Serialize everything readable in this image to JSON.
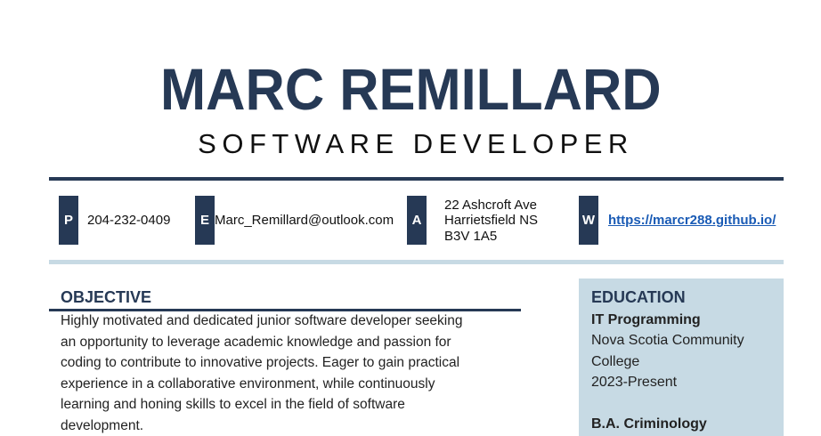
{
  "header": {
    "name": "MARC REMILLARD",
    "title": "SOFTWARE DEVELOPER"
  },
  "contact": {
    "phone": {
      "badge": "P",
      "value": "204-232-0409"
    },
    "email": {
      "badge": "E",
      "value": "Marc_Remillard@outlook.com"
    },
    "address": {
      "badge": "A",
      "lines": [
        "22 Ashcroft Ave",
        "Harrietsfield NS",
        "B3V 1A5"
      ]
    },
    "website": {
      "badge": "W",
      "value": "https://marcr288.github.io/"
    }
  },
  "objective": {
    "heading": "OBJECTIVE",
    "lines": [
      "Highly motivated and dedicated junior software developer seeking",
      "an opportunity to leverage academic knowledge and passion for",
      "coding to contribute to innovative projects. Eager to gain practical",
      "experience in a collaborative environment, while continuously",
      "learning and honing skills to excel in the field of software",
      "development."
    ]
  },
  "education": {
    "heading": "EDUCATION",
    "entries": [
      {
        "program": "IT Programming",
        "school_lines": [
          "Nova Scotia Community",
          "College"
        ],
        "dates": "2023-Present"
      },
      {
        "program": "B.A. Criminology"
      }
    ]
  },
  "colors": {
    "navy": "#263955",
    "light_blue": "#c7dae4",
    "link": "#1a5bb5"
  }
}
